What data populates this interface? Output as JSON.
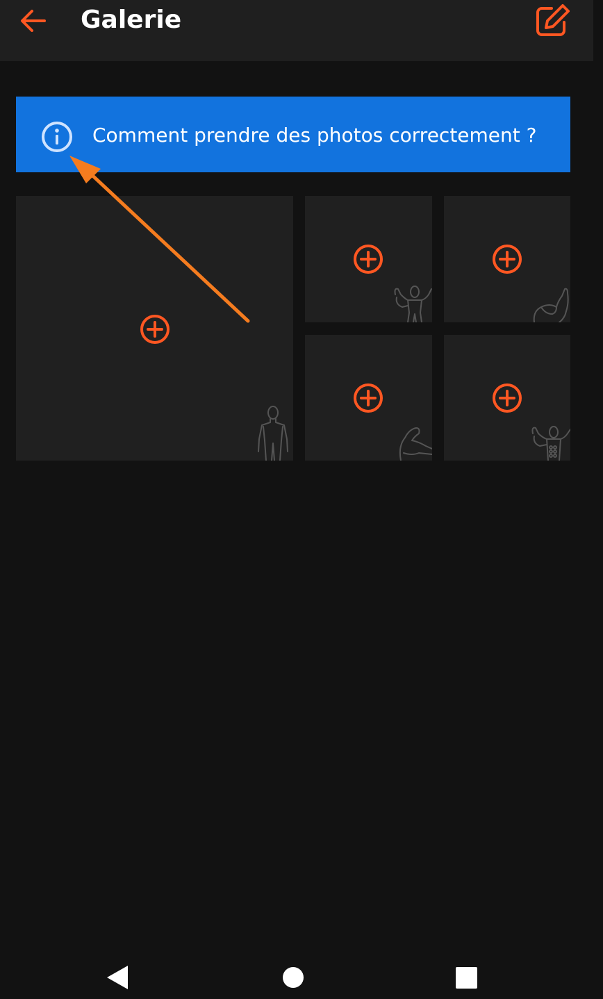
{
  "header": {
    "title": "Galerie",
    "back_icon": "arrow-left-icon",
    "edit_icon": "edit-icon"
  },
  "banner": {
    "text": "Comment prendre des photos correctement ?",
    "icon": "info-icon"
  },
  "gallery": {
    "tiles": [
      {
        "pose": "front-body-silhouette-icon"
      },
      {
        "pose": "front-double-biceps-silhouette-icon"
      },
      {
        "pose": "arm-flex-silhouette-icon"
      },
      {
        "pose": "side-arm-silhouette-icon"
      },
      {
        "pose": "back-double-biceps-silhouette-icon"
      }
    ],
    "add_icon": "plus-circle-icon"
  },
  "navigation": {
    "back": "triangle-back-icon",
    "home": "circle-home-icon",
    "recents": "square-recents-icon"
  },
  "colors": {
    "accent": "#ff5722",
    "banner": "#1273de",
    "annotation": "#f57c1f",
    "background": "#121212",
    "tile": "#202020"
  }
}
